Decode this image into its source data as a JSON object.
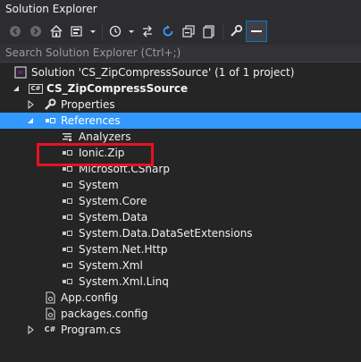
{
  "window": {
    "title": "Solution Explorer"
  },
  "toolbar": {
    "buttons": [
      "back-icon",
      "forward-icon",
      "home-icon",
      "switch-views-icon",
      "history-icon",
      "pending-changes-icon",
      "sync-icon",
      "refresh-icon",
      "collapse-all-icon",
      "show-all-files-icon",
      "properties-icon",
      "preview-icon"
    ]
  },
  "search": {
    "placeholder": "Search Solution Explorer (Ctrl+;)"
  },
  "tree": {
    "solution": "Solution 'CS_ZipCompressSource' (1 of 1 project)",
    "project": "CS_ZipCompressSource",
    "project_badge": "C#",
    "properties": "Properties",
    "references": "References",
    "analyzers": "Analyzers",
    "refs": [
      "Ionic.Zip",
      "Microsoft.CSharp",
      "System",
      "System.Core",
      "System.Data",
      "System.Data.DataSetExtensions",
      "System.Net.Http",
      "System.Xml",
      "System.Xml.Linq"
    ],
    "app_config": "App.config",
    "packages_config": "packages.config",
    "program": "Program.cs",
    "program_badge": "C#"
  },
  "colors": {
    "background": "#252526",
    "selection": "#3399ff",
    "highlight_box": "#e81123"
  }
}
